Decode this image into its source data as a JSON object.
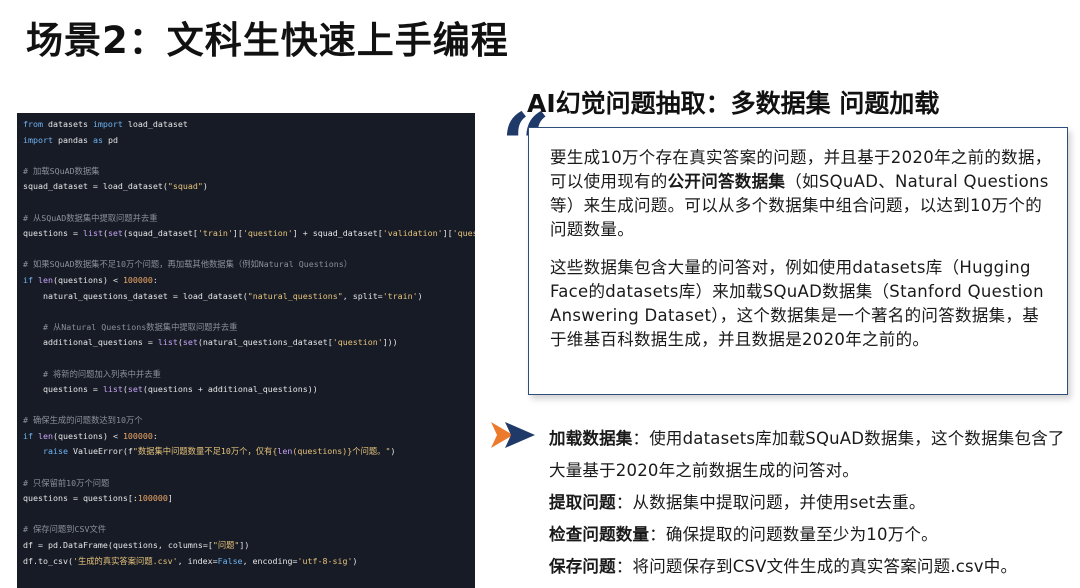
{
  "title": "场景2：文科生快速上手编程",
  "code": {
    "lines": [
      [
        {
          "t": "from",
          "c": "kw"
        },
        {
          "t": " datasets "
        },
        {
          "t": "import",
          "c": "kw"
        },
        {
          "t": " load_dataset"
        }
      ],
      [
        {
          "t": "import",
          "c": "kw"
        },
        {
          "t": " pandas "
        },
        {
          "t": "as",
          "c": "kw"
        },
        {
          "t": " pd"
        }
      ],
      [],
      [
        {
          "t": "# 加载SQuAD数据集",
          "c": "cm"
        }
      ],
      [
        {
          "t": "squad_dataset = load_dataset("
        },
        {
          "t": "\"squad\"",
          "c": "st"
        },
        {
          "t": ")"
        }
      ],
      [],
      [
        {
          "t": "# 从SQuAD数据集中提取问题并去重",
          "c": "cm"
        }
      ],
      [
        {
          "t": "questions = "
        },
        {
          "t": "list",
          "c": "fn"
        },
        {
          "t": "("
        },
        {
          "t": "set",
          "c": "fn"
        },
        {
          "t": "(squad_dataset["
        },
        {
          "t": "'train'",
          "c": "st"
        },
        {
          "t": "]["
        },
        {
          "t": "'question'",
          "c": "st"
        },
        {
          "t": "] + squad_dataset["
        },
        {
          "t": "'validation'",
          "c": "st"
        },
        {
          "t": "]["
        },
        {
          "t": "'question'",
          "c": "st"
        },
        {
          "t": "]))"
        }
      ],
      [],
      [
        {
          "t": "# 如果SQuAD数据集不足10万个问题，再加载其他数据集（例如Natural Questions）",
          "c": "cm"
        }
      ],
      [
        {
          "t": "if",
          "c": "kw"
        },
        {
          "t": " "
        },
        {
          "t": "len",
          "c": "fn"
        },
        {
          "t": "(questions) < "
        },
        {
          "t": "100000",
          "c": "nm"
        },
        {
          "t": ":"
        }
      ],
      [
        {
          "t": "    natural_questions_dataset = load_dataset("
        },
        {
          "t": "\"natural_questions\"",
          "c": "st"
        },
        {
          "t": ", split="
        },
        {
          "t": "'train'",
          "c": "st"
        },
        {
          "t": ")"
        }
      ],
      [],
      [
        {
          "t": "    # 从Natural Questions数据集中提取问题并去重",
          "c": "cm"
        }
      ],
      [
        {
          "t": "    additional_questions = "
        },
        {
          "t": "list",
          "c": "fn"
        },
        {
          "t": "("
        },
        {
          "t": "set",
          "c": "fn"
        },
        {
          "t": "(natural_questions_dataset["
        },
        {
          "t": "'question'",
          "c": "st"
        },
        {
          "t": "]))"
        }
      ],
      [],
      [
        {
          "t": "    # 将新的问题加入列表中并去重",
          "c": "cm"
        }
      ],
      [
        {
          "t": "    questions = "
        },
        {
          "t": "list",
          "c": "fn"
        },
        {
          "t": "("
        },
        {
          "t": "set",
          "c": "fn"
        },
        {
          "t": "(questions + additional_questions))"
        }
      ],
      [],
      [
        {
          "t": "# 确保生成的问题数达到10万个",
          "c": "cm"
        }
      ],
      [
        {
          "t": "if",
          "c": "kw"
        },
        {
          "t": " "
        },
        {
          "t": "len",
          "c": "fn"
        },
        {
          "t": "(questions) < "
        },
        {
          "t": "100000",
          "c": "nm"
        },
        {
          "t": ":"
        }
      ],
      [
        {
          "t": "    "
        },
        {
          "t": "raise",
          "c": "kw"
        },
        {
          "t": " ValueError(f"
        },
        {
          "t": "\"数据集中问题数量不足10万个，仅有{",
          "c": "st"
        },
        {
          "t": "len",
          "c": "fn"
        },
        {
          "t": "(questions)",
          "c": "st"
        },
        {
          "t": "}个问题。\"",
          "c": "st"
        },
        {
          "t": ")"
        }
      ],
      [],
      [
        {
          "t": "# 只保留前10万个问题",
          "c": "cm"
        }
      ],
      [
        {
          "t": "questions = questions[:"
        },
        {
          "t": "100000",
          "c": "nm"
        },
        {
          "t": "]"
        }
      ],
      [],
      [
        {
          "t": "# 保存问题到CSV文件",
          "c": "cm"
        }
      ],
      [
        {
          "t": "df = pd.DataFrame(questions, columns=["
        },
        {
          "t": "\"问题\"",
          "c": "st"
        },
        {
          "t": "])"
        }
      ],
      [
        {
          "t": "df.to_csv("
        },
        {
          "t": "'生成的真实答案问题.csv'",
          "c": "st"
        },
        {
          "t": ", index="
        },
        {
          "t": "False",
          "c": "kw"
        },
        {
          "t": ", encoding="
        },
        {
          "t": "'utf-8-sig'",
          "c": "st"
        },
        {
          "t": ")"
        }
      ]
    ]
  },
  "section": {
    "title": "AI幻觉问题抽取：多数据集 问题加载",
    "quote_mark": "“",
    "para1": {
      "before": "要生成10万个存在真实答案的问题，并且基于2020年之前的数据，可以使用现有的",
      "bold": "公开问答数据集",
      "after": "（如SQuAD、Natural Questions等）来生成问题。可以从多个数据集中组合问题，以达到10万个的问题数量。"
    },
    "para2": "这些数据集包含大量的问答对，例如使用datasets库（Hugging Face的datasets库）来加载SQuAD数据集（Stanford Question Answering Dataset），这个数据集是一个著名的问答数据集，基于维基百科数据生成，并且数据是2020年之前的。"
  },
  "bullets": [
    {
      "head": "加载数据集",
      "text": "：使用datasets库加载SQuAD数据集，这个数据集包含了大量基于2020年之前数据生成的问答对。"
    },
    {
      "head": "提取问题",
      "text": "：从数据集中提取问题，并使用set去重。"
    },
    {
      "head": "检查问题数量",
      "text": "：确保提取的问题数量至少为10万个。"
    },
    {
      "head": "保存问题",
      "text": "：将问题保存到CSV文件生成的真实答案问题.csv中。"
    }
  ],
  "colors": {
    "title": "#111111",
    "code_bg": "#171b26",
    "box_border": "#2f4d7a",
    "arrow_orange": "#ec7a2c",
    "arrow_blue": "#1f3a68"
  },
  "icons": {
    "quote": "quote-icon",
    "arrow": "arrow-icon"
  }
}
